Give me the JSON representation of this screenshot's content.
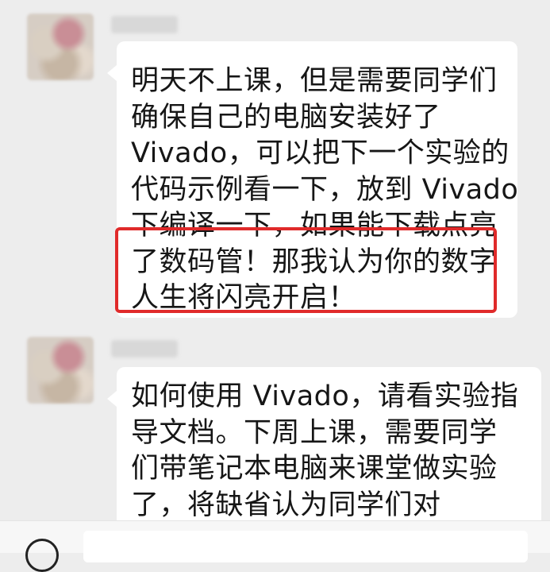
{
  "messages": [
    {
      "lines": [
        "明天不上课，但是需要同学们",
        "确保自己的电脑安装好了",
        "Vivado，可以把下一个实验的",
        "代码示例看一下，放到 Vivado",
        "下编译一下，如果能下载点亮",
        "了数码管！那我认为你的数字",
        "人生将闪亮开启！"
      ]
    },
    {
      "lines": [
        "如何使用 Vivado，请看实验指",
        "导文档。下周上课，需要同学",
        "们带笔记本电脑来课堂做实验",
        "了，将缺省认为同学们对"
      ]
    }
  ],
  "colors": {
    "background": "#ededed",
    "bubble": "#ffffff",
    "highlight": "#e02a2a"
  },
  "icons": [
    "voice-icon"
  ]
}
